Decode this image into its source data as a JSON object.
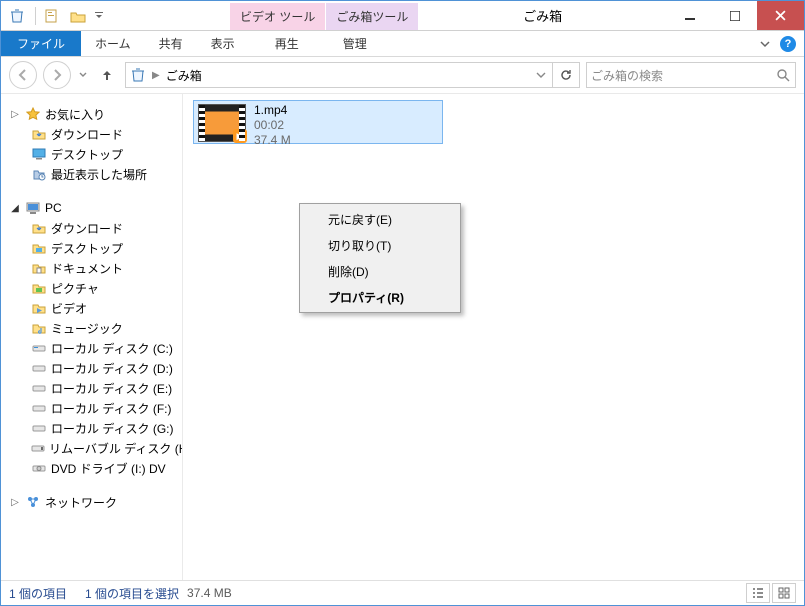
{
  "title": "ごみ箱",
  "toolTabs": {
    "video": "ビデオ ツール",
    "recycle": "ごみ箱ツール"
  },
  "winControls": {
    "min": "min",
    "max": "max",
    "close": "close"
  },
  "ribbon": {
    "file": "ファイル",
    "home": "ホーム",
    "share": "共有",
    "view": "表示",
    "play": "再生",
    "manage": "管理"
  },
  "address": {
    "location": "ごみ箱",
    "searchPlaceholder": "ごみ箱の検索"
  },
  "tree": {
    "favorites": "お気に入り",
    "fav_items": {
      "downloads": "ダウンロード",
      "desktop": "デスクトップ",
      "recent": "最近表示した場所"
    },
    "pc": "PC",
    "pc_items": {
      "downloads": "ダウンロード",
      "desktop": "デスクトップ",
      "documents": "ドキュメント",
      "pictures": "ピクチャ",
      "videos": "ビデオ",
      "music": "ミュージック",
      "diskC": "ローカル ディスク (C:)",
      "diskD": "ローカル ディスク (D:)",
      "diskE": "ローカル ディスク (E:)",
      "diskF": "ローカル ディスク (F:)",
      "diskG": "ローカル ディスク (G:)",
      "remH": "リムーバブル ディスク (H:)",
      "dvdI": "DVD ドライブ (I:) DV"
    },
    "network": "ネットワーク"
  },
  "file": {
    "name": "1.mp4",
    "duration": "00:02",
    "size": "37.4 M"
  },
  "contextMenu": {
    "restore": "元に戻す(E)",
    "cut": "切り取り(T)",
    "delete": "削除(D)",
    "properties": "プロパティ(R)"
  },
  "status": {
    "count": "1 個の項目",
    "selected": "1 個の項目を選択",
    "size": "37.4 MB"
  }
}
